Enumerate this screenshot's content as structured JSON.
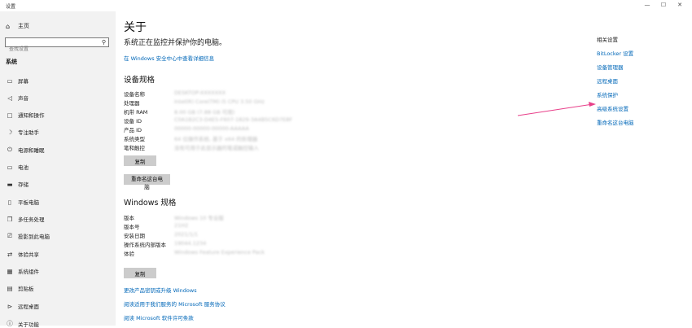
{
  "window": {
    "title": "设置",
    "controls": [
      "—",
      "☐",
      "✕"
    ]
  },
  "sidebar": {
    "home_label": "主页",
    "search_placeholder": "查找设置",
    "section_label": "系统",
    "items": [
      {
        "label": "屏幕",
        "icon": "display-icon"
      },
      {
        "label": "声音",
        "icon": "speaker-icon"
      },
      {
        "label": "通知和操作",
        "icon": "notification-icon"
      },
      {
        "label": "专注助手",
        "icon": "moon-icon"
      },
      {
        "label": "电源和睡眠",
        "icon": "power-icon"
      },
      {
        "label": "电池",
        "icon": "battery-icon"
      },
      {
        "label": "存储",
        "icon": "storage-icon"
      },
      {
        "label": "平板电脑",
        "icon": "tablet-icon"
      },
      {
        "label": "多任务处理",
        "icon": "multitask-icon"
      },
      {
        "label": "投影到此电脑",
        "icon": "project-icon"
      },
      {
        "label": "体验共享",
        "icon": "share-icon"
      },
      {
        "label": "系统组件",
        "icon": "components-icon"
      },
      {
        "label": "剪贴板",
        "icon": "clipboard-icon"
      },
      {
        "label": "远程桌面",
        "icon": "remote-icon"
      },
      {
        "label": "关于功能",
        "icon": "info-icon"
      }
    ]
  },
  "main": {
    "title": "关于",
    "subtitle": "系统正在监控并保护你的电脑。",
    "security_link": "在 Windows 安全中心中查看详细信息",
    "device_specs": {
      "heading": "设备规格",
      "rows": [
        {
          "key": "设备名称",
          "value": "DESKTOP-XXXXXXX"
        },
        {
          "key": "处理器",
          "value": "Intel(R) Core(TM) i5 CPU 3.50 GHz"
        },
        {
          "key": "机带 RAM",
          "value": "8.00 GB (7.88 GB 可用)"
        },
        {
          "key": "设备 ID",
          "value": "C0A1B2C3-D4E5-F607-1829-3A4B5C6D7E8F"
        },
        {
          "key": "产品 ID",
          "value": "00000-00000-00000-AAAAA"
        },
        {
          "key": "系统类型",
          "value": "64 位操作系统, 基于 x64 的处理器"
        },
        {
          "key": "笔和触控",
          "value": "没有可用于此显示器的笔或触控输入"
        }
      ],
      "copy_button": "复制"
    },
    "rename_button": "重命名这台电脑",
    "windows_specs": {
      "heading": "Windows 规格",
      "rows": [
        {
          "key": "版本",
          "value": "Windows 10 专业版"
        },
        {
          "key": "版本号",
          "value": "21H2"
        },
        {
          "key": "安装日期",
          "value": "2021/1/1"
        },
        {
          "key": "操作系统内部版本",
          "value": "19044.1234"
        },
        {
          "key": "体验",
          "value": "Windows Feature Experience Pack"
        }
      ],
      "copy_button": "复制"
    },
    "bottom_links": [
      "更改产品密钥或升级 Windows",
      "阅读适用于我们服务的 Microsoft 服务协议",
      "阅读 Microsoft 软件许可条款"
    ]
  },
  "related": {
    "heading": "相关设置",
    "links": [
      "BitLocker 设置",
      "设备管理器",
      "远程桌面",
      "系统保护",
      "高级系统设置",
      "重命名这台电脑"
    ]
  },
  "colors": {
    "sidebar_bg": "#f2f2f2",
    "link": "#0067b8",
    "button_bg": "#cccccc",
    "arrow": "#e8408a"
  }
}
